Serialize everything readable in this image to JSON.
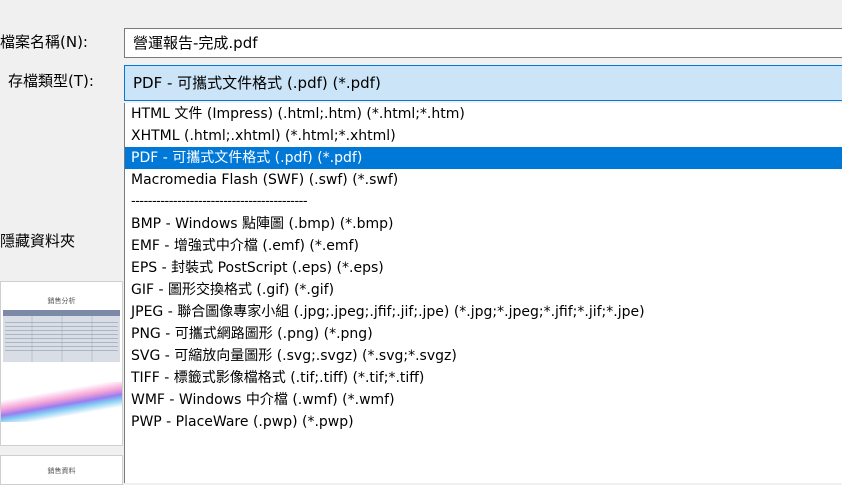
{
  "form": {
    "filename_label": "檔案名稱(N):",
    "filename_value": "營運報告-完成.pdf",
    "filetype_label": "存檔類型(T):",
    "filetype_value": "PDF - 可攜式文件格式 (.pdf) (*.pdf)",
    "folder_label": "隱藏資料夾"
  },
  "filetype_options": [
    {
      "label": "HTML 文件 (Impress) (.html;.htm) (*.html;*.htm)",
      "selected": false
    },
    {
      "label": "XHTML (.html;.xhtml) (*.html;*.xhtml)",
      "selected": false
    },
    {
      "label": "PDF - 可攜式文件格式 (.pdf) (*.pdf)",
      "selected": true
    },
    {
      "label": "Macromedia Flash (SWF) (.swf) (*.swf)",
      "selected": false
    },
    {
      "label": "------------------------------------------",
      "selected": false
    },
    {
      "label": "BMP - Windows 點陣圖 (.bmp) (*.bmp)",
      "selected": false
    },
    {
      "label": "EMF - 增強式中介檔 (.emf) (*.emf)",
      "selected": false
    },
    {
      "label": "EPS - 封裝式 PostScript (.eps) (*.eps)",
      "selected": false
    },
    {
      "label": "GIF - 圖形交換格式 (.gif) (*.gif)",
      "selected": false
    },
    {
      "label": "JPEG - 聯合圖像專家小組 (.jpg;.jpeg;.jfif;.jif;.jpe) (*.jpg;*.jpeg;*.jfif;*.jif;*.jpe)",
      "selected": false
    },
    {
      "label": "PNG - 可攜式網路圖形 (.png) (*.png)",
      "selected": false
    },
    {
      "label": "SVG - 可縮放向量圖形 (.svg;.svgz) (*.svg;*.svgz)",
      "selected": false
    },
    {
      "label": "TIFF - 標籤式影像檔格式 (.tif;.tiff) (*.tif;*.tiff)",
      "selected": false
    },
    {
      "label": "WMF - Windows 中介檔 (.wmf) (*.wmf)",
      "selected": false
    },
    {
      "label": "PWP - PlaceWare (.pwp) (*.pwp)",
      "selected": false
    }
  ],
  "thumbnails": [
    {
      "title": "銷售分析"
    },
    {
      "title": "銷售資料"
    }
  ],
  "colors": {
    "selection": "#0078d7",
    "selected_field_bg": "#cce4f7"
  }
}
